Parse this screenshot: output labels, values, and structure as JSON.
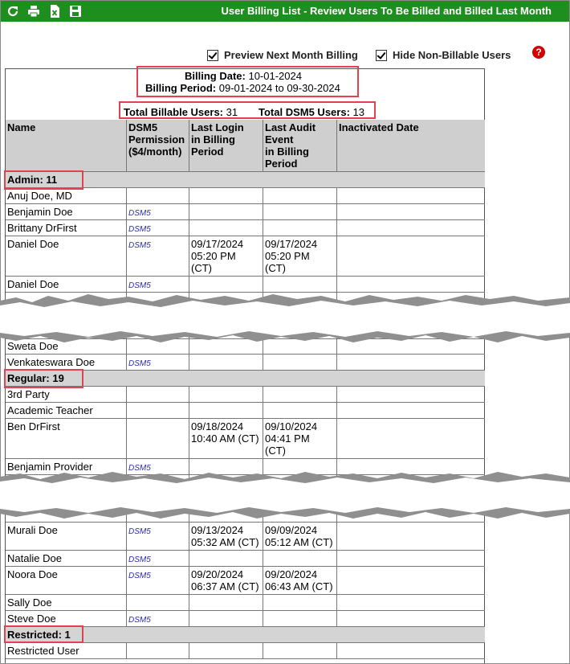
{
  "toolbar": {
    "title": "User Billing List - Review Users To Be Billed and Billed Last Month",
    "icons": [
      "refresh-icon",
      "print-icon",
      "excel-export-icon",
      "save-icon"
    ]
  },
  "options": {
    "preview_label": "Preview Next Month Billing",
    "hide_label": "Hide Non-Billable Users",
    "help": "?"
  },
  "summary": {
    "billing_date_label": "Billing Date:",
    "billing_date": "10-01-2024",
    "billing_period_label": "Billing Period:",
    "billing_period": "09-01-2024 to 09-30-2024",
    "total_billable_label": "Total Billable Users:",
    "total_billable": "31",
    "total_dsm5_label": "Total DSM5 Users:",
    "total_dsm5": "13"
  },
  "columns": {
    "name": "Name",
    "dsm5_l1": "DSM5",
    "dsm5_l2": "Permission",
    "dsm5_l3": "($4/month)",
    "login_l1": "Last Login",
    "login_l2": "in Billing",
    "login_l3": "Period",
    "audit_l1": "Last Audit",
    "audit_l2": "Event",
    "audit_l3": "in Billing",
    "audit_l4": "Period",
    "inactivated": "Inactivated Date"
  },
  "groups": {
    "admin": "Admin: 11",
    "regular": "Regular: 19",
    "restricted": "Restricted: 1"
  },
  "rows": {
    "r1": {
      "name": "Anuj Doe, MD"
    },
    "r2": {
      "name": "Benjamin Doe",
      "dsm": "DSM5"
    },
    "r3": {
      "name": "Brittany DrFirst",
      "dsm": "DSM5"
    },
    "r4": {
      "name": "Daniel Doe",
      "dsm": "DSM5",
      "login1": "09/17/2024",
      "login2": "05:20 PM",
      "login3": "(CT)",
      "audit1": "09/17/2024",
      "audit2": "05:20 PM",
      "audit3": "(CT)"
    },
    "r5": {
      "name": "Daniel Doe",
      "dsm": "DSM5"
    },
    "r6": {
      "name": "Sweta Doe"
    },
    "r7": {
      "name": "Venkateswara Doe",
      "dsm": "DSM5"
    },
    "r8": {
      "name": "3rd Party"
    },
    "r9": {
      "name": "Academic Teacher"
    },
    "r10": {
      "name": "Ben DrFirst",
      "login1": "09/18/2024",
      "login2": "10:40 AM (CT)",
      "audit1": "09/10/2024",
      "audit2": "04:41 PM",
      "audit3": "(CT)"
    },
    "r11": {
      "name": "Benjamin Provider",
      "dsm": "DSM5"
    },
    "r12": {
      "name": "Murali Doe",
      "dsm": "DSM5",
      "login1": "09/13/2024",
      "login2": "05:32 AM (CT)",
      "audit1": "09/09/2024",
      "audit2": "05:12 AM (CT)"
    },
    "r13": {
      "name": "Natalie Doe",
      "dsm": "DSM5"
    },
    "r14": {
      "name": "Noora Doe",
      "dsm": "DSM5",
      "login1": "09/20/2024",
      "login2": "06:37 AM (CT)",
      "audit1": "09/20/2024",
      "audit2": "06:43 AM (CT)"
    },
    "r15": {
      "name": "Sally Doe"
    },
    "r16": {
      "name": "Steve Doe",
      "dsm": "DSM5"
    },
    "r17": {
      "name": "Restricted User"
    }
  },
  "colors": {
    "topbar": "#1e8f1e",
    "highlight": "#e3414f",
    "header_bg": "#cfcfcf",
    "dsm_link": "#2a2ab5"
  }
}
